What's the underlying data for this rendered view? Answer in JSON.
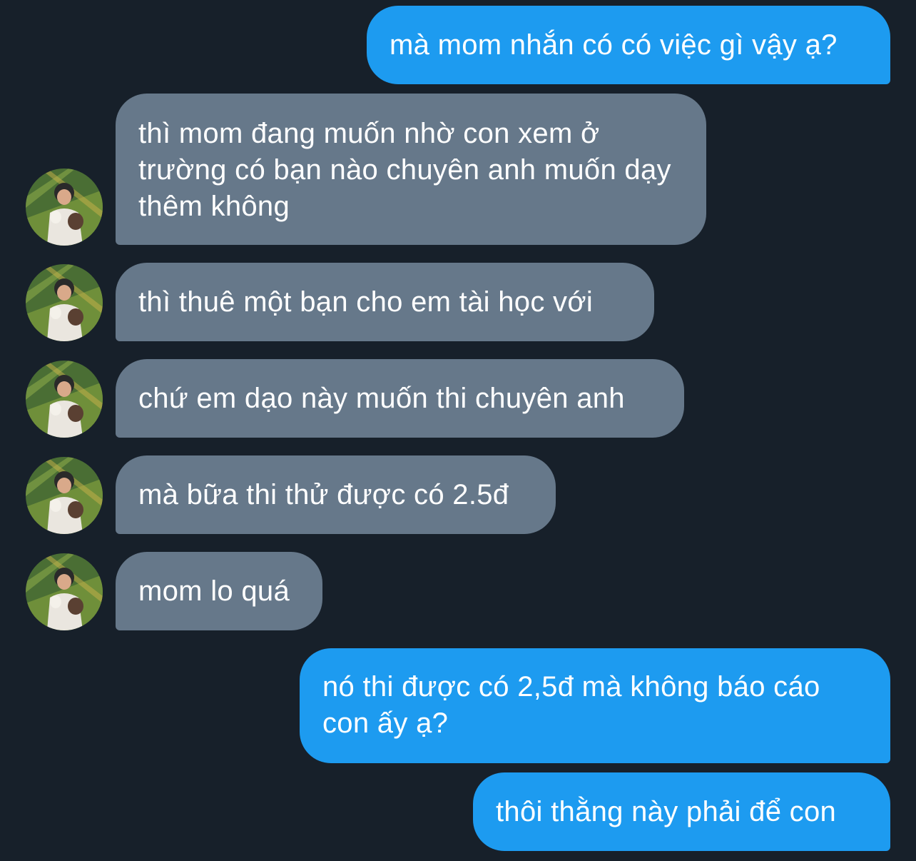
{
  "conversation": {
    "messages": [
      {
        "sender": "me",
        "text": "mà mom nhắn có có việc gì vậy ạ?"
      },
      {
        "sender": "other",
        "text": "thì mom đang muốn nhờ con xem ở trường có bạn nào chuyên anh muốn dạy thêm không"
      },
      {
        "sender": "other",
        "text": "thì thuê một bạn cho em tài học với"
      },
      {
        "sender": "other",
        "text": "chứ em dạo này muốn thi chuyên anh"
      },
      {
        "sender": "other",
        "text": "mà bữa thi thử được có 2.5đ"
      },
      {
        "sender": "other",
        "text": "mom lo quá"
      },
      {
        "sender": "me",
        "text": "nó thi được có 2,5đ mà không báo cáo con ấy ạ?"
      },
      {
        "sender": "me",
        "text": "thôi thằng này phải để con"
      }
    ]
  },
  "colors": {
    "background": "#17202a",
    "outgoing_bubble": "#1d9bf0",
    "incoming_bubble": "#66788a",
    "text": "#ffffff"
  },
  "icons": {
    "avatar": "profile-photo-person-with-pet"
  }
}
